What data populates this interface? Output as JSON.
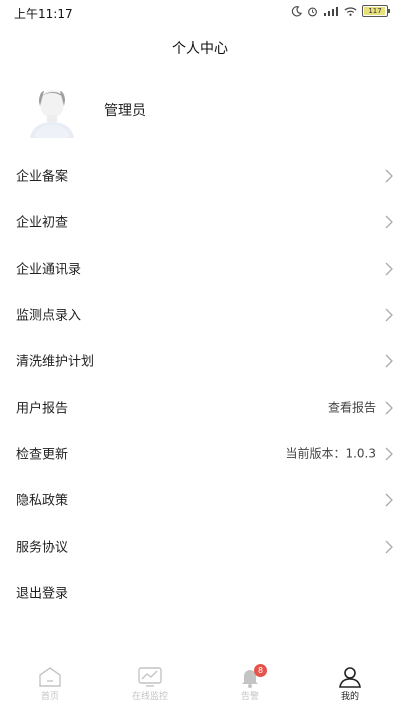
{
  "status_bar": {
    "time": "上午11:17",
    "battery": "117",
    "accent": "#e8e07a"
  },
  "header": {
    "title": "个人中心"
  },
  "profile": {
    "name": "管理员",
    "avatar_icon": "user-avatar-icon"
  },
  "menu": {
    "items": [
      {
        "label": "企业备案",
        "value": ""
      },
      {
        "label": "企业初查",
        "value": ""
      },
      {
        "label": "企业通讯录",
        "value": ""
      },
      {
        "label": "监测点录入",
        "value": ""
      },
      {
        "label": "清洗维护计划",
        "value": ""
      },
      {
        "label": "用户报告",
        "value": "查看报告"
      },
      {
        "label": "检查更新",
        "value": "当前版本：1.0.3"
      },
      {
        "label": "隐私政策",
        "value": ""
      },
      {
        "label": "服务协议",
        "value": ""
      },
      {
        "label": "退出登录",
        "value": ""
      }
    ]
  },
  "tabbar": {
    "tabs": [
      {
        "label": "首页",
        "icon": "home-icon",
        "active": false
      },
      {
        "label": "在线监控",
        "icon": "monitor-icon",
        "active": false
      },
      {
        "label": "告警",
        "icon": "bell-icon",
        "active": false,
        "badge": "8"
      },
      {
        "label": "我的",
        "icon": "user-icon",
        "active": true
      }
    ],
    "inactive_color": "#c4c4c4",
    "active_color": "#222222",
    "badge_color": "#e5534b"
  }
}
